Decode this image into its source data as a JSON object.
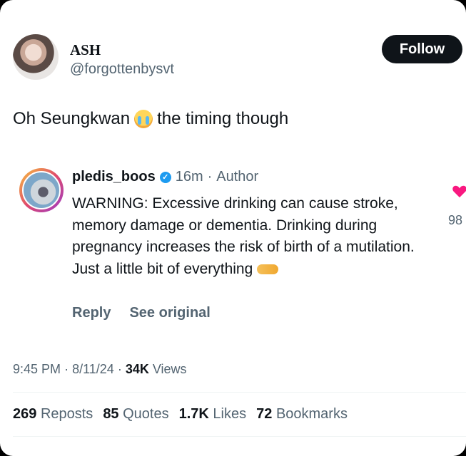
{
  "author": {
    "display_name": "ASH",
    "handle": "@forgottenbysvt"
  },
  "follow_label": "Follow",
  "tweet": {
    "text_before": "Oh Seungkwan",
    "emoji": "loudly-crying-face",
    "text_after": "the timing though"
  },
  "quoted": {
    "username": "pledis_boos",
    "time": "16m",
    "author_tag": "Author",
    "separator": "·",
    "body": "WARNING: Excessive drinking can cause stroke, memory damage or dementia. Drinking during pregnancy increases the risk of birth of a mutilation. Just a little bit of everything",
    "body_emoji": "handshake",
    "reply_label": "Reply",
    "see_original_label": "See original",
    "like_count_partial": "98"
  },
  "meta": {
    "time": "9:45 PM",
    "date": "8/11/24",
    "views_count": "34K",
    "views_label": "Views"
  },
  "stats": {
    "reposts_count": "269",
    "reposts_label": "Reposts",
    "quotes_count": "85",
    "quotes_label": "Quotes",
    "likes_count": "1.7K",
    "likes_label": "Likes",
    "bookmarks_count": "72",
    "bookmarks_label": "Bookmarks"
  },
  "colors": {
    "text": "#0f1419",
    "muted": "#536471",
    "verified": "#1d9bf0",
    "heart": "#f91880"
  }
}
